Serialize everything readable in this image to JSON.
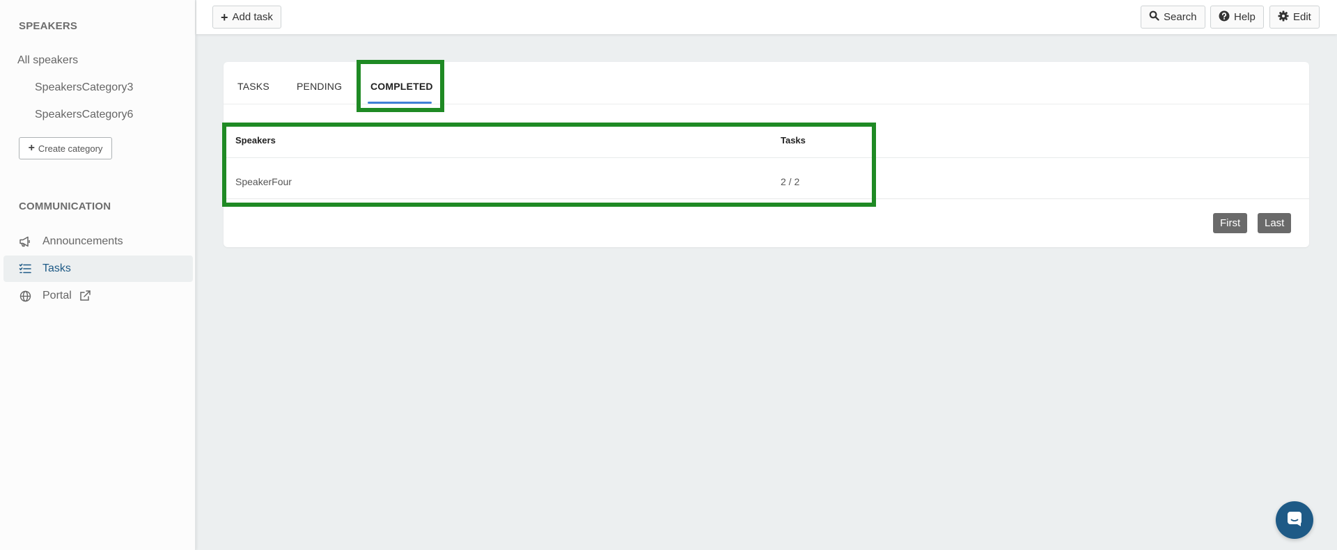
{
  "sidebar": {
    "speakers_heading": "SPEAKERS",
    "all_speakers": "All speakers",
    "categories": [
      "SpeakersCategory3",
      "SpeakersCategory6"
    ],
    "create_category": "Create category",
    "communication_heading": "COMMUNICATION",
    "nav": [
      {
        "label": "Announcements",
        "icon": "megaphone-icon",
        "active": false
      },
      {
        "label": "Tasks",
        "icon": "task-list-icon",
        "active": true
      },
      {
        "label": "Portal",
        "icon": "globe-icon",
        "active": false
      }
    ]
  },
  "topbar": {
    "add_task": "Add task",
    "search": "Search",
    "help": "Help",
    "edit": "Edit"
  },
  "tabs": {
    "items": [
      "TASKS",
      "PENDING",
      "COMPLETED"
    ],
    "active": "COMPLETED"
  },
  "table": {
    "headers": [
      "Speakers",
      "Tasks"
    ],
    "rows": [
      {
        "speaker": "SpeakerFour",
        "tasks": "2 / 2"
      }
    ]
  },
  "pagination": {
    "first": "First",
    "last": "Last"
  },
  "colors": {
    "accent": "#1e5a86",
    "tab_underline": "#3f80d6",
    "highlight": "#1f8a24"
  }
}
